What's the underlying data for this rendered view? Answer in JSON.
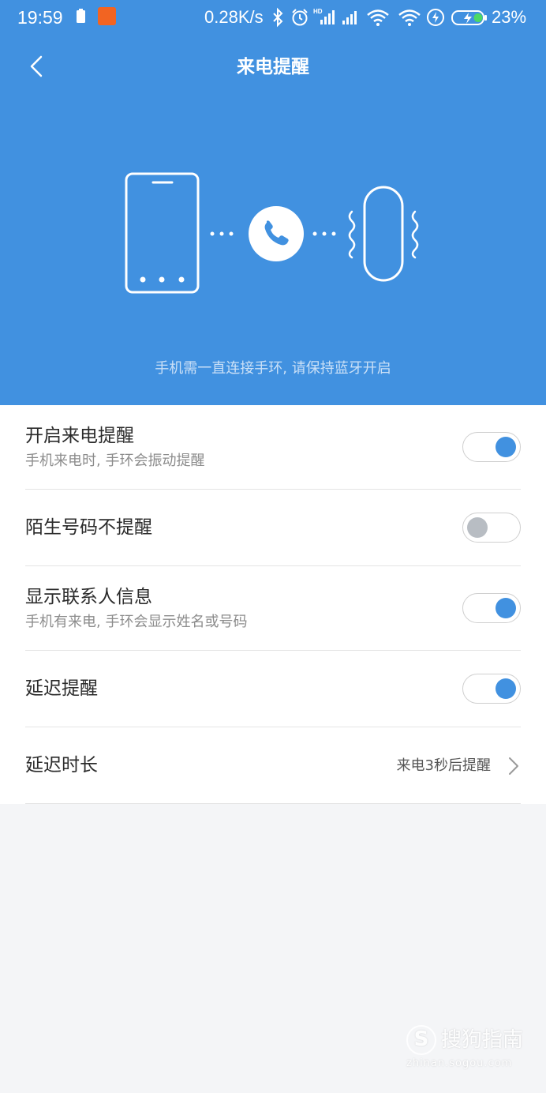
{
  "status_bar": {
    "time": "19:59",
    "net_speed": "0.28K/s",
    "battery_percent": "23%",
    "icons": [
      "battery-mini-icon",
      "app-notification-icon",
      "bluetooth-icon",
      "alarm-icon",
      "hd-signal-icon",
      "signal-icon",
      "wifi-icon",
      "wifi-icon",
      "flash-icon",
      "battery-charging-icon"
    ]
  },
  "nav": {
    "title": "来电提醒",
    "back_icon": "chevron-left-icon"
  },
  "illustration": {
    "icons": [
      "phone-outline-icon",
      "call-icon",
      "band-vibrate-icon"
    ]
  },
  "hint": "手机需一直连接手环, 请保持蓝牙开启",
  "settings": [
    {
      "title": "开启来电提醒",
      "subtitle": "手机来电时, 手环会振动提醒",
      "toggle": true
    },
    {
      "title": "陌生号码不提醒",
      "toggle": false
    },
    {
      "title": "显示联系人信息",
      "subtitle": "手机有来电, 手环会显示姓名或号码",
      "toggle": true
    },
    {
      "title": "延迟提醒",
      "toggle": true
    },
    {
      "title": "延迟时长",
      "value": "来电3秒后提醒"
    }
  ],
  "watermark": {
    "logo_letter": "S",
    "text": "搜狗指南",
    "url": "zhinan.sogou.com"
  },
  "colors": {
    "accent": "#4191e0",
    "toggle_off_knob": "#b8bdc3",
    "background": "#f4f5f7"
  }
}
